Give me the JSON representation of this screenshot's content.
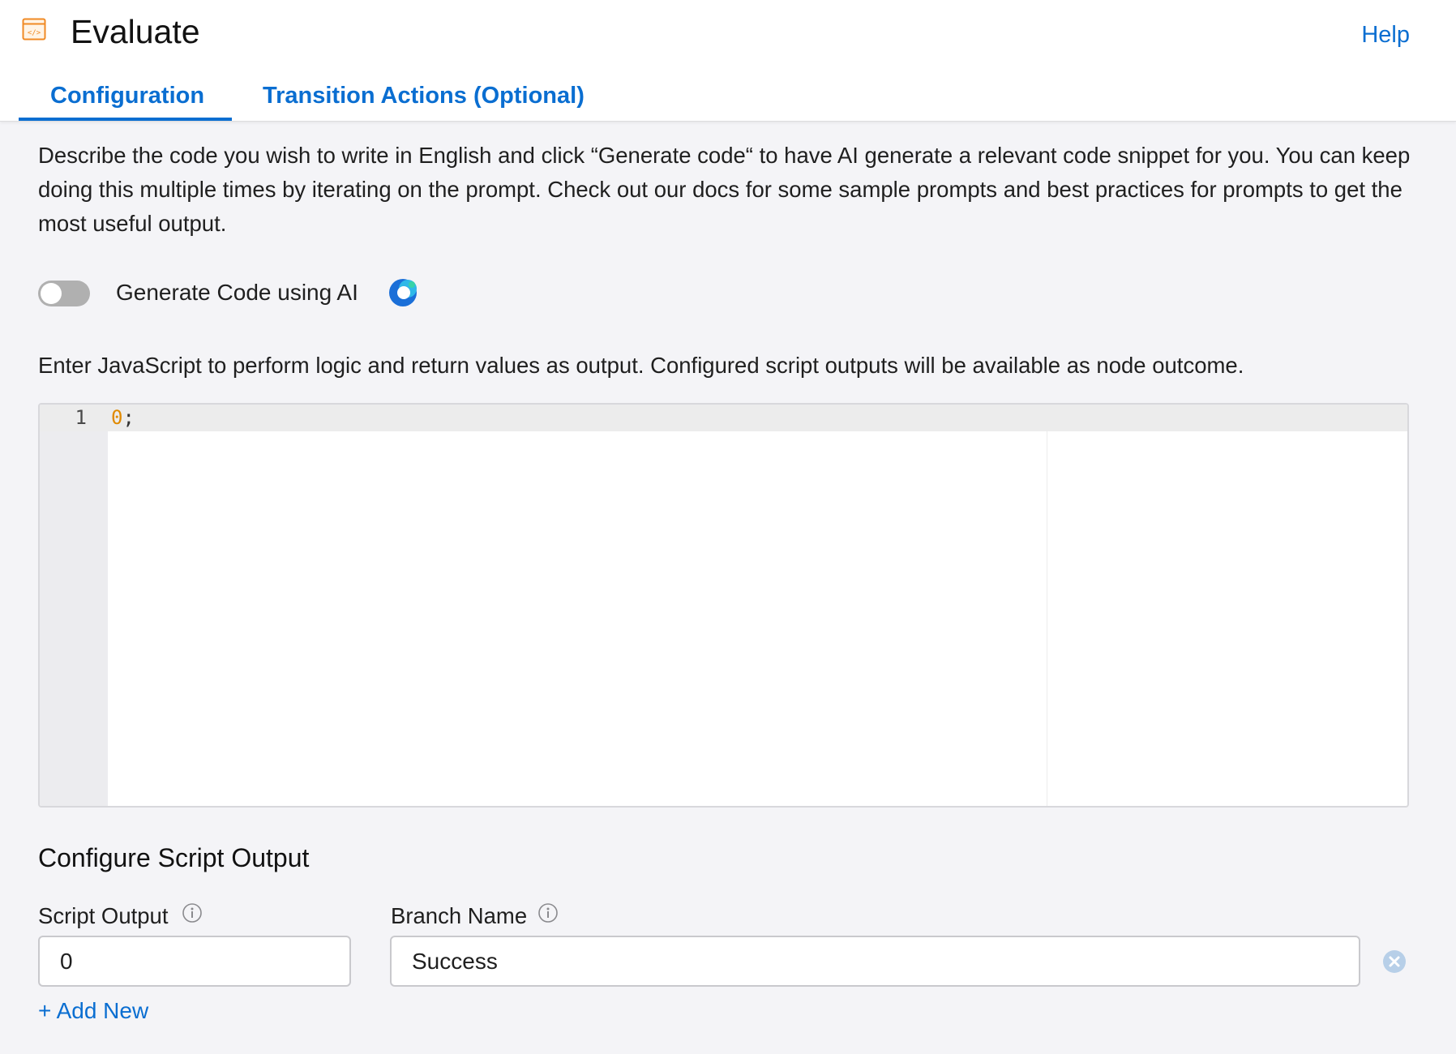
{
  "header": {
    "title": "Evaluate",
    "help_label": "Help",
    "icon": "code-window-icon"
  },
  "tabs": [
    {
      "label": "Configuration",
      "active": true
    },
    {
      "label": "Transition Actions (Optional)",
      "active": false
    }
  ],
  "description": "Describe the code you wish to write in English and click “Generate code“ to have AI generate a relevant code snippet for you. You can keep doing this multiple times by iterating on the prompt. Check out our docs for some sample prompts and best practices for prompts to get the most useful output.",
  "ai_toggle": {
    "label": "Generate Code using AI",
    "enabled": false,
    "icon": "ai-assistant-icon"
  },
  "instructions": "Enter JavaScript to perform logic and return values as output. Configured script outputs will be available as node outcome.",
  "editor": {
    "lines": [
      {
        "number": "1",
        "number_token": "0",
        "rest": ";"
      }
    ]
  },
  "script_output_section": {
    "title": "Configure Script Output",
    "script_output_label": "Script Output",
    "branch_name_label": "Branch Name",
    "rows": [
      {
        "script_output": "0",
        "branch_name": "Success"
      }
    ],
    "add_new_label": "+ Add New"
  },
  "colors": {
    "accent": "#0a6ed1",
    "code_number": "#e08a00",
    "background": "#f4f4f7"
  }
}
